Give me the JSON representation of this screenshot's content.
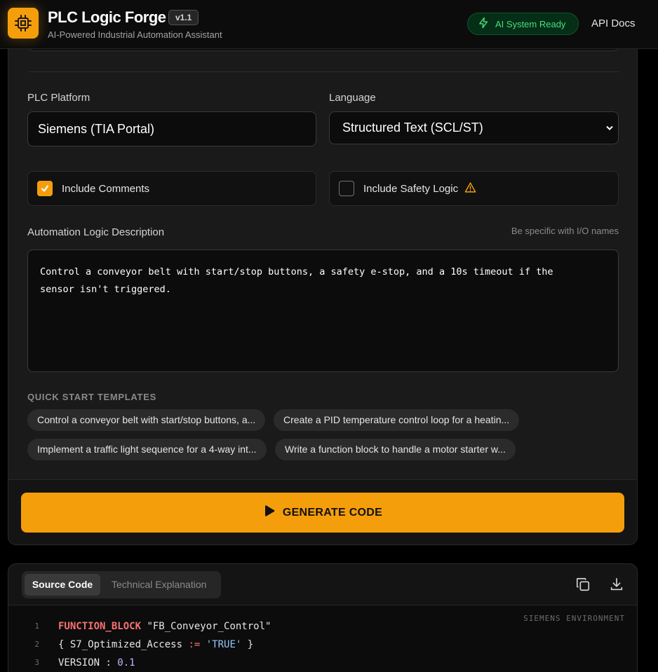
{
  "header": {
    "title": "PLC Logic Forge",
    "version": "v1.1",
    "subtitle": "AI-Powered Industrial Automation Assistant",
    "status": "AI System Ready",
    "api_docs": "API Docs"
  },
  "form": {
    "platform_label": "PLC Platform",
    "platform_value": "Siemens (TIA Portal)",
    "language_label": "Language",
    "language_value": "Structured Text (SCL/ST)",
    "include_comments": {
      "label": "Include Comments",
      "checked": true
    },
    "include_safety": {
      "label": "Include Safety Logic",
      "checked": false
    },
    "description_label": "Automation Logic Description",
    "description_hint": "Be specific with I/O names",
    "description_value": "Control a conveyor belt with start/stop buttons, a safety e-stop, and a 10s timeout if the\nsensor isn't triggered."
  },
  "templates": {
    "heading": "QUICK START TEMPLATES",
    "items": [
      "Control a conveyor belt with start/stop buttons, a...",
      "Create a PID temperature control loop for a heatin...",
      "Implement a traffic light sequence for a 4-way int...",
      "Write a function block to handle a motor starter w..."
    ]
  },
  "generate_label": "GENERATE CODE",
  "output": {
    "tabs": [
      "Source Code",
      "Technical Explanation"
    ],
    "active_tab": "Source Code",
    "environment": "SIEMENS ENVIRONMENT",
    "lines": [
      {
        "n": "1",
        "keyword": "FUNCTION_BLOCK",
        "rest": " \"FB_Conveyor_Control\""
      },
      {
        "n": "2",
        "pre": "{ S7_Optimized_Access ",
        "op": ":=",
        "val": " 'TRUE'",
        "post": " }"
      },
      {
        "n": "3",
        "pre": "VERSION ",
        "op2": ":",
        "num": " 0.1"
      }
    ]
  },
  "colors": {
    "accent": "#f59e0b",
    "status_green": "#4ade80",
    "background": "#000000",
    "card": "#1a1a1a"
  }
}
